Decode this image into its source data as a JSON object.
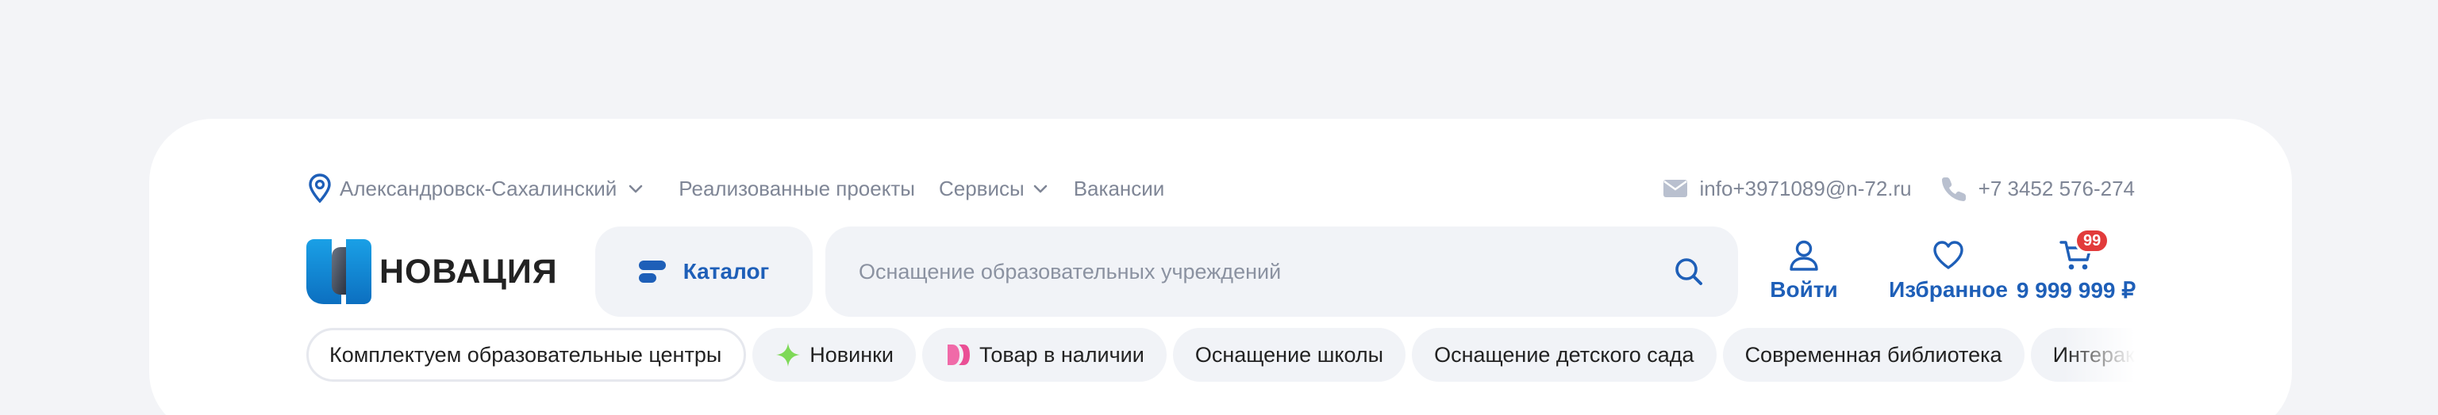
{
  "topbar": {
    "city": "Александровск-Сахалинский",
    "links": [
      {
        "label": "Реализованные проекты",
        "has_dropdown": false
      },
      {
        "label": "Сервисы",
        "has_dropdown": true
      },
      {
        "label": "Вакансии",
        "has_dropdown": false
      }
    ],
    "email": "info+3971089@n-72.ru",
    "phone": "+7 3452 576-274"
  },
  "logo": {
    "name": "НОВАЦИЯ"
  },
  "catalog": {
    "label": "Каталог"
  },
  "search": {
    "placeholder": "Оснащение образовательных учреждений"
  },
  "actions": {
    "login": "Войти",
    "favorites": "Избранное",
    "cart_total": "9 999 999 ₽",
    "cart_count": "99"
  },
  "chips": [
    {
      "label": "Комплектуем образовательные центры",
      "style": "outlined",
      "icon": "none"
    },
    {
      "label": "Новинки",
      "style": "filled",
      "icon": "sparkle-icon"
    },
    {
      "label": "Товар в наличии",
      "style": "filled",
      "icon": "stock-icon"
    },
    {
      "label": "Оснащение школы",
      "style": "filled",
      "icon": "none"
    },
    {
      "label": "Оснащение детского сада",
      "style": "filled",
      "icon": "none"
    },
    {
      "label": "Современная библиотека",
      "style": "filled",
      "icon": "none"
    },
    {
      "label": "Интерактивное",
      "style": "filled",
      "icon": "none"
    }
  ],
  "colors": {
    "accent": "#1e5fb8",
    "badge": "#e23b3b",
    "muted_text": "#7f8696",
    "chip_bg": "#f1f3f7",
    "page_bg": "#f3f4f7"
  }
}
